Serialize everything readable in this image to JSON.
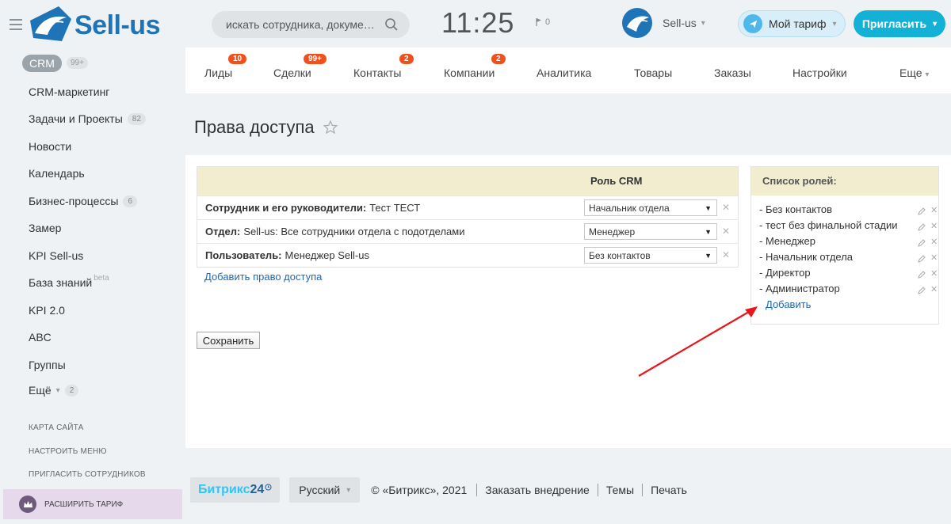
{
  "header": {
    "logo_text": "Sell-us",
    "search_placeholder": "искать сотрудника, докумен...",
    "clock": "11:25",
    "flag_count": "0",
    "company_name": "Sell-us",
    "tariff_label": "Мой тариф",
    "invite_label": "Пригласить"
  },
  "sidebar": {
    "crm_label": "CRM",
    "crm_count": "99+",
    "items": [
      {
        "label": "CRM-маркетинг",
        "count": ""
      },
      {
        "label": "Задачи и Проекты",
        "count": "82"
      },
      {
        "label": "Новости",
        "count": ""
      },
      {
        "label": "Календарь",
        "count": ""
      },
      {
        "label": "Бизнес-процессы",
        "count": "6"
      },
      {
        "label": "Замер",
        "count": ""
      },
      {
        "label": "KPI Sell-us",
        "count": ""
      },
      {
        "label": "База знаний",
        "count": "",
        "beta": "beta"
      },
      {
        "label": "KPI 2.0",
        "count": ""
      },
      {
        "label": "ABC",
        "count": ""
      },
      {
        "label": "Группы",
        "count": ""
      },
      {
        "label": "Ещё",
        "count": "2"
      }
    ],
    "site_map": "КАРТА САЙТА",
    "configure_menu": "НАСТРОИТЬ МЕНЮ",
    "invite_employees": "ПРИГЛАСИТЬ СОТРУДНИКОВ",
    "upgrade_label": "РАСШИРИТЬ ТАРИФ"
  },
  "topnav": {
    "tabs": [
      {
        "label": "Лиды",
        "badge": "10"
      },
      {
        "label": "Сделки",
        "badge": "99+"
      },
      {
        "label": "Контакты",
        "badge": "2"
      },
      {
        "label": "Компании",
        "badge": "2"
      },
      {
        "label": "Аналитика",
        "badge": ""
      },
      {
        "label": "Товары",
        "badge": ""
      },
      {
        "label": "Заказы",
        "badge": ""
      },
      {
        "label": "Настройки",
        "badge": ""
      },
      {
        "label": "Еще",
        "badge": ""
      }
    ]
  },
  "page": {
    "title": "Права доступа",
    "table_head_role": "Роль CRM",
    "rows": [
      {
        "bold": "Сотрудник и его руководители:",
        "text": "Тест ТЕСТ",
        "role": "Начальник отдела"
      },
      {
        "bold": "Отдел:",
        "text": "Sell-us: Все сотрудники отдела с подотделами",
        "role": "Менеджер"
      },
      {
        "bold": "Пользователь:",
        "text": "Менеджер Sell-us",
        "role": "Без контактов"
      }
    ],
    "add_right": "Добавить право доступа",
    "save_label": "Сохранить",
    "roles_title": "Список ролей:",
    "roles": [
      "- Без контактов",
      "- тест без финальной стадии",
      "- Менеджер",
      "- Начальник отдела",
      "- Директор",
      "- Администратор"
    ],
    "roles_add": "Добавить"
  },
  "footer": {
    "brand_a": "Битрикс",
    "brand_b": "24",
    "language": "Русский",
    "copyright": "© «Битрикс», 2021",
    "order": "Заказать внедрение",
    "themes": "Темы",
    "print": "Печать"
  },
  "colors": {
    "brand_blue": "#1f73b7",
    "invite_cyan": "#12b1d5",
    "badge_red": "#f0501e",
    "table_head": "#f2edce",
    "link_blue": "#2067b0",
    "arrow_red": "#e8161b"
  },
  "icons": {
    "menu": "burger-menu-icon",
    "search": "search-icon",
    "flag": "flag-icon",
    "tariff": "rocket-icon",
    "favorite": "star-icon",
    "edit": "pencil-icon",
    "delete": "close-icon",
    "upgrade": "crown-icon"
  }
}
